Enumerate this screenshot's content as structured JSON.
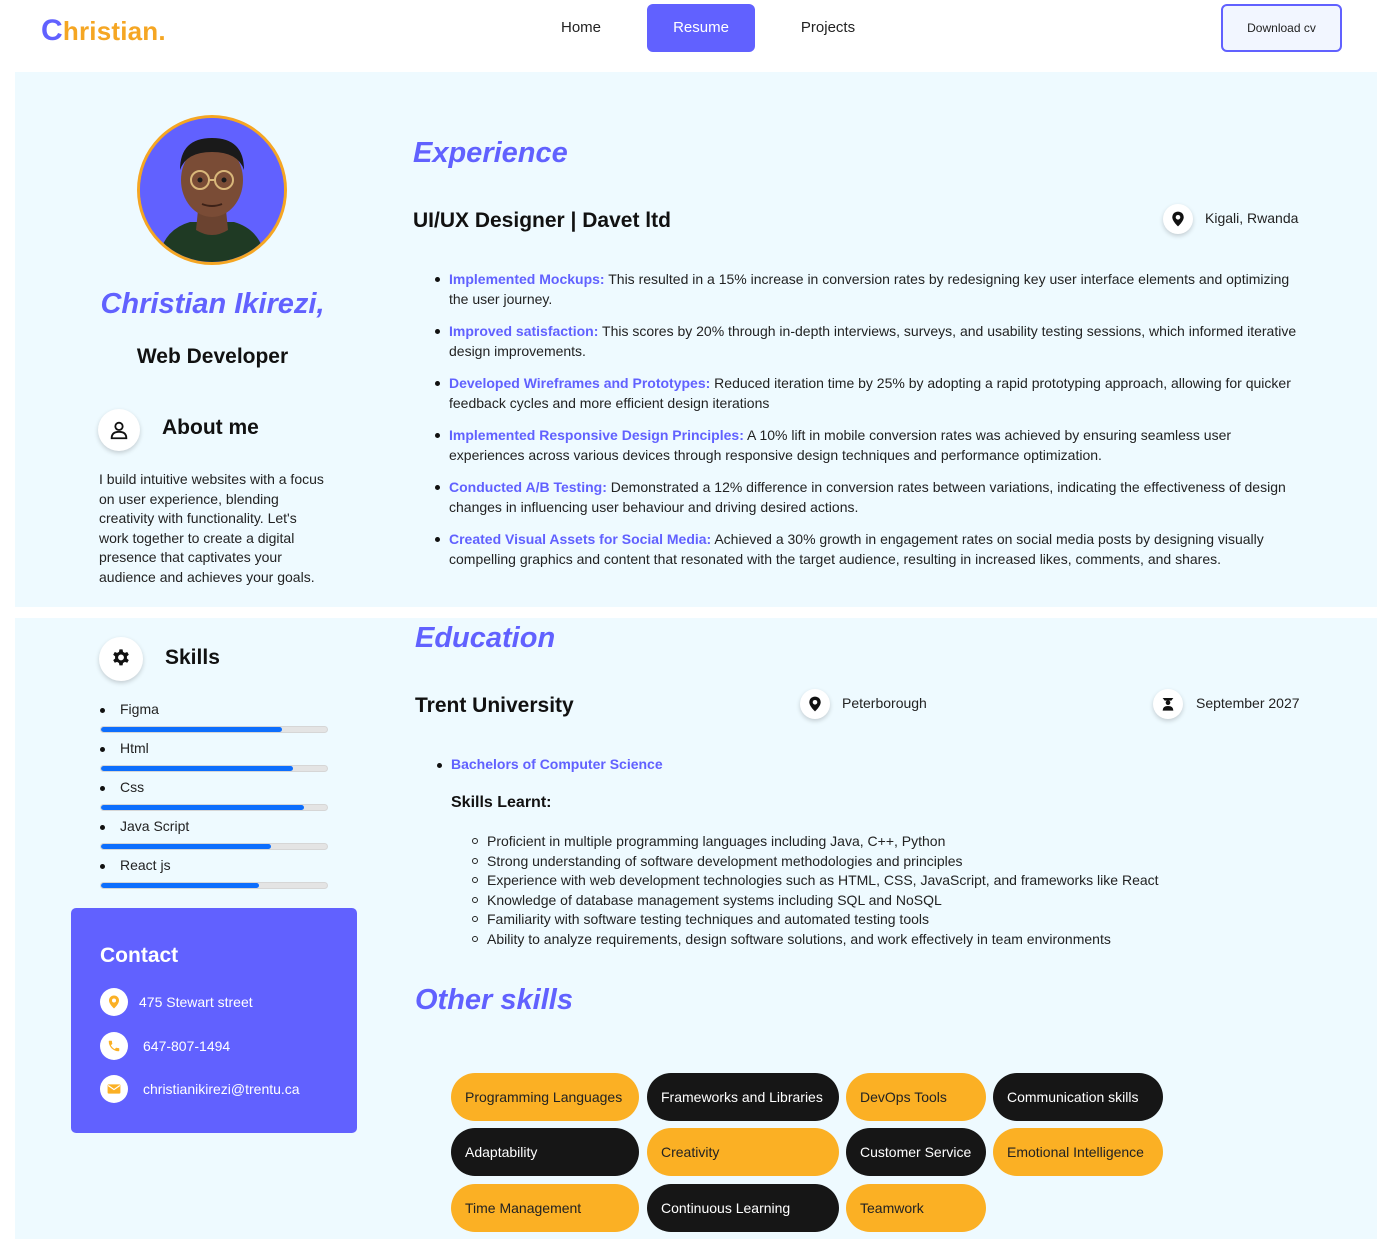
{
  "header": {
    "logo_cap": "C",
    "logo_rest": "hristian.",
    "nav": [
      "Home",
      "Resume",
      "Projects"
    ],
    "active_nav": "Resume",
    "download_label": "Download cv"
  },
  "profile": {
    "name": "Christian Ikirezi,",
    "role": "Web Developer",
    "about_title": "About me",
    "about_text": "I build intuitive websites with a focus on user experience, blending creativity with functionality. Let's work together to create a digital presence that captivates your audience and achieves your goals."
  },
  "experience": {
    "title": "Experience",
    "job": "UI/UX Designer | Davet ltd",
    "location": "Kigali, Rwanda",
    "items": [
      {
        "head": "Implemented Mockups:",
        "text": " This resulted in a 15% increase in conversion rates by redesigning key user interface elements and optimizing the user journey."
      },
      {
        "head": "Improved satisfaction:",
        "text": " This scores by 20% through in-depth interviews, surveys, and usability testing sessions, which informed iterative design improvements."
      },
      {
        "head": "Developed Wireframes and Prototypes:",
        "text": " Reduced iteration time by 25% by adopting a rapid prototyping approach, allowing for quicker feedback cycles and more efficient design iterations"
      },
      {
        "head": "Implemented Responsive Design Principles:",
        "text": " A 10% lift in mobile conversion rates was achieved by ensuring seamless user experiences across various devices through responsive design techniques and performance optimization."
      },
      {
        "head": "Conducted A/B Testing:",
        "text": " Demonstrated a 12% difference in conversion rates between variations, indicating the effectiveness of design changes in influencing user behaviour and driving desired actions."
      },
      {
        "head": "Created Visual Assets for Social Media:",
        "text": " Achieved a 30% growth in engagement rates on social media posts by designing visually compelling graphics and content that resonated with the target audience, resulting in increased likes, comments, and shares."
      }
    ]
  },
  "skills": {
    "title": "Skills",
    "items": [
      {
        "label": "Figma",
        "level": 0.8
      },
      {
        "label": "Html",
        "level": 0.85
      },
      {
        "label": "Css",
        "level": 0.9
      },
      {
        "label": "Java Script",
        "level": 0.75
      },
      {
        "label": "React js",
        "level": 0.7
      }
    ]
  },
  "contact": {
    "title": "Contact",
    "address": "475 Stewart street",
    "phone": "647-807-1494",
    "email": "christianikirezi@trentu.ca"
  },
  "education": {
    "title": "Education",
    "school": "Trent University",
    "location": "Peterborough",
    "date": "September 2027",
    "degree": "Bachelors of Computer Science",
    "learnt_title": "Skills Learnt:",
    "learnt": [
      "Proficient in multiple programming languages including Java, C++, Python",
      "Strong understanding of software development methodologies and principles",
      "Experience with web development technologies such as HTML, CSS, JavaScript, and frameworks like React",
      "Knowledge of database management systems including SQL and NoSQL",
      "Familiarity with software testing techniques and automated testing tools",
      "Ability to analyze requirements, design software solutions, and work effectively in team environments"
    ]
  },
  "other_skills": {
    "title": "Other skills",
    "tags": [
      "Programming Languages",
      "Frameworks and Libraries",
      "DevOps Tools",
      "Communication skills",
      "Adaptability",
      "Creativity",
      "Customer Service",
      "Emotional Intelligence",
      "Time Management",
      "Continuous Learning",
      "Teamwork"
    ]
  },
  "colors": {
    "accent": "#6161ff",
    "orange": "#fbb024",
    "panel": "#eefaff",
    "bar": "#0d6efd"
  }
}
